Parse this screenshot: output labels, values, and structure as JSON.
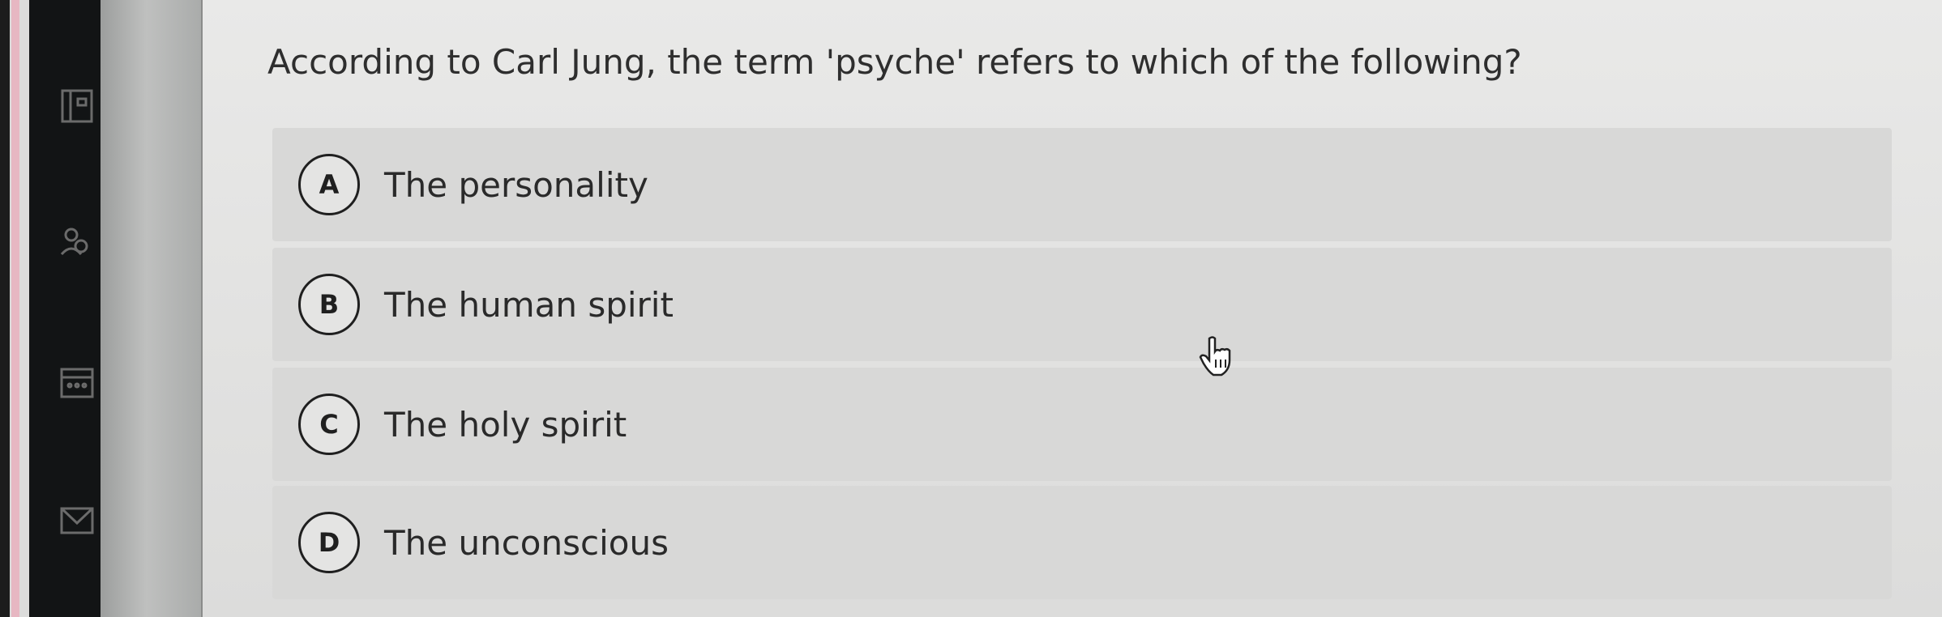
{
  "question": {
    "text": "According to Carl Jung, the term 'psyche' refers to which of the following?"
  },
  "options": [
    {
      "letter": "A",
      "text": "The personality"
    },
    {
      "letter": "B",
      "text": "The human spirit"
    },
    {
      "letter": "C",
      "text": "The holy spirit"
    },
    {
      "letter": "D",
      "text": "The unconscious"
    }
  ],
  "sidebar": {
    "icons": [
      "book-icon",
      "people-icon",
      "calendar-icon",
      "mail-icon"
    ]
  },
  "colors": {
    "option_bg": "#d8d8d7",
    "text": "#2a2a2a"
  }
}
